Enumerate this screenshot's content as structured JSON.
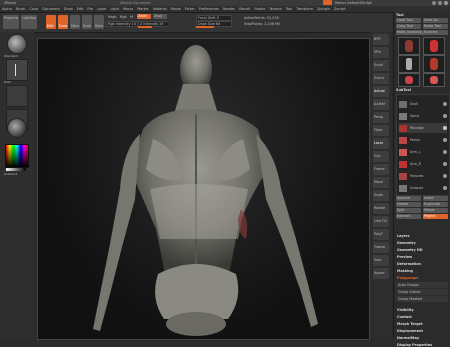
{
  "window": {
    "title_left": "ZBrush",
    "title_mid": "ZBrush Document",
    "title_right": "Menus DefaultZScript",
    "menus": [
      "Alpha",
      "Brush",
      "Color",
      "Document",
      "Draw",
      "Edit",
      "File",
      "Layer",
      "Light",
      "Macro",
      "Marker",
      "Material",
      "Movie",
      "Picker",
      "Preferences",
      "Render",
      "Stencil",
      "Stroke",
      "Texture",
      "Tool",
      "Transform",
      "Zplugin",
      "Zscript"
    ]
  },
  "toolbar": {
    "projection_label": "Projection Master",
    "lightbox_label": "LightBox",
    "edit_label": "Edit",
    "draw_label": "Draw",
    "move_label": "Move",
    "scale_label": "Scale",
    "rotate_label": "Rotate",
    "mrgb_label": "Mrgb",
    "rgb_label": "Rgb",
    "m_label": "M",
    "zadd_label": "Zadd",
    "zsub_label": "Zsub",
    "rgb_intensity": "Rgb Intensity 100",
    "z_intensity": "Z Intensity 25",
    "focal_shift": "Focal Shift 0",
    "draw_size": "Draw Size 64",
    "active_points": "ActivePoints: 52,034",
    "total_points": "TotalPoints: 2.246 Mil"
  },
  "left_shelf": {
    "brush_label": "Standard",
    "stroke_label": "Dots",
    "alpha_label": "Alpha Off",
    "texture_label": "Texture Off",
    "material_label": "MatCap Gray",
    "color_label": "Gradient"
  },
  "right_shelf": {
    "buttons": [
      "BPR",
      "SPix",
      "Scroll",
      "Zoom",
      "Actual",
      "AAHalf",
      "Persp",
      "Floor",
      "Local",
      "Gyz",
      "Frame",
      "Move",
      "Scale",
      "Rotate",
      "Line Fill",
      "PolyF",
      "Transp",
      "Solo",
      "Xpose"
    ]
  },
  "tool_palette": {
    "title": "Tool",
    "load_tool": "Load Tool",
    "save_as": "Save As",
    "copy_tool": "Copy Tool",
    "paste_tool": "Paste Tool",
    "import": "Import",
    "export": "Export",
    "clone": "Clone",
    "make_polymesh": "Make PolyMesh3D",
    "goz": "GoZ",
    "all": "All",
    "visible": "Visible",
    "current_tool": "Male_Anatomy_Ecorche",
    "lightbox_tools": "Lightbox▸Tools",
    "subtool_title": "SubTool",
    "subtools": [
      "Skull",
      "Spine",
      "Ribcage",
      "Pelvis",
      "Arm_L",
      "Arm_R",
      "Muscles",
      "Scapula"
    ],
    "subtool_actions": [
      "Append",
      "Insert",
      "Delete",
      "Duplicate",
      "Split",
      "Merge",
      "Remesh",
      "Project"
    ],
    "sections": [
      "Layers",
      "Geometry",
      "Geometry HD",
      "Preview",
      "Deformation",
      "Masking",
      "Polygroups",
      "Morph Target",
      "Display Properties",
      "Import",
      "Export"
    ],
    "polygroups_items": [
      "Auto Groups",
      "Group Visible",
      "Group Masked"
    ],
    "bottom_items": [
      "Visibility",
      "Contact",
      "Morph Target",
      "Displacement",
      "NormalMap",
      "Display Properties"
    ]
  },
  "colors": {
    "accent": "#e0642a",
    "panel": "#2b2b2b",
    "viewport": "#141414",
    "swatch_primary": "#ffffff"
  }
}
